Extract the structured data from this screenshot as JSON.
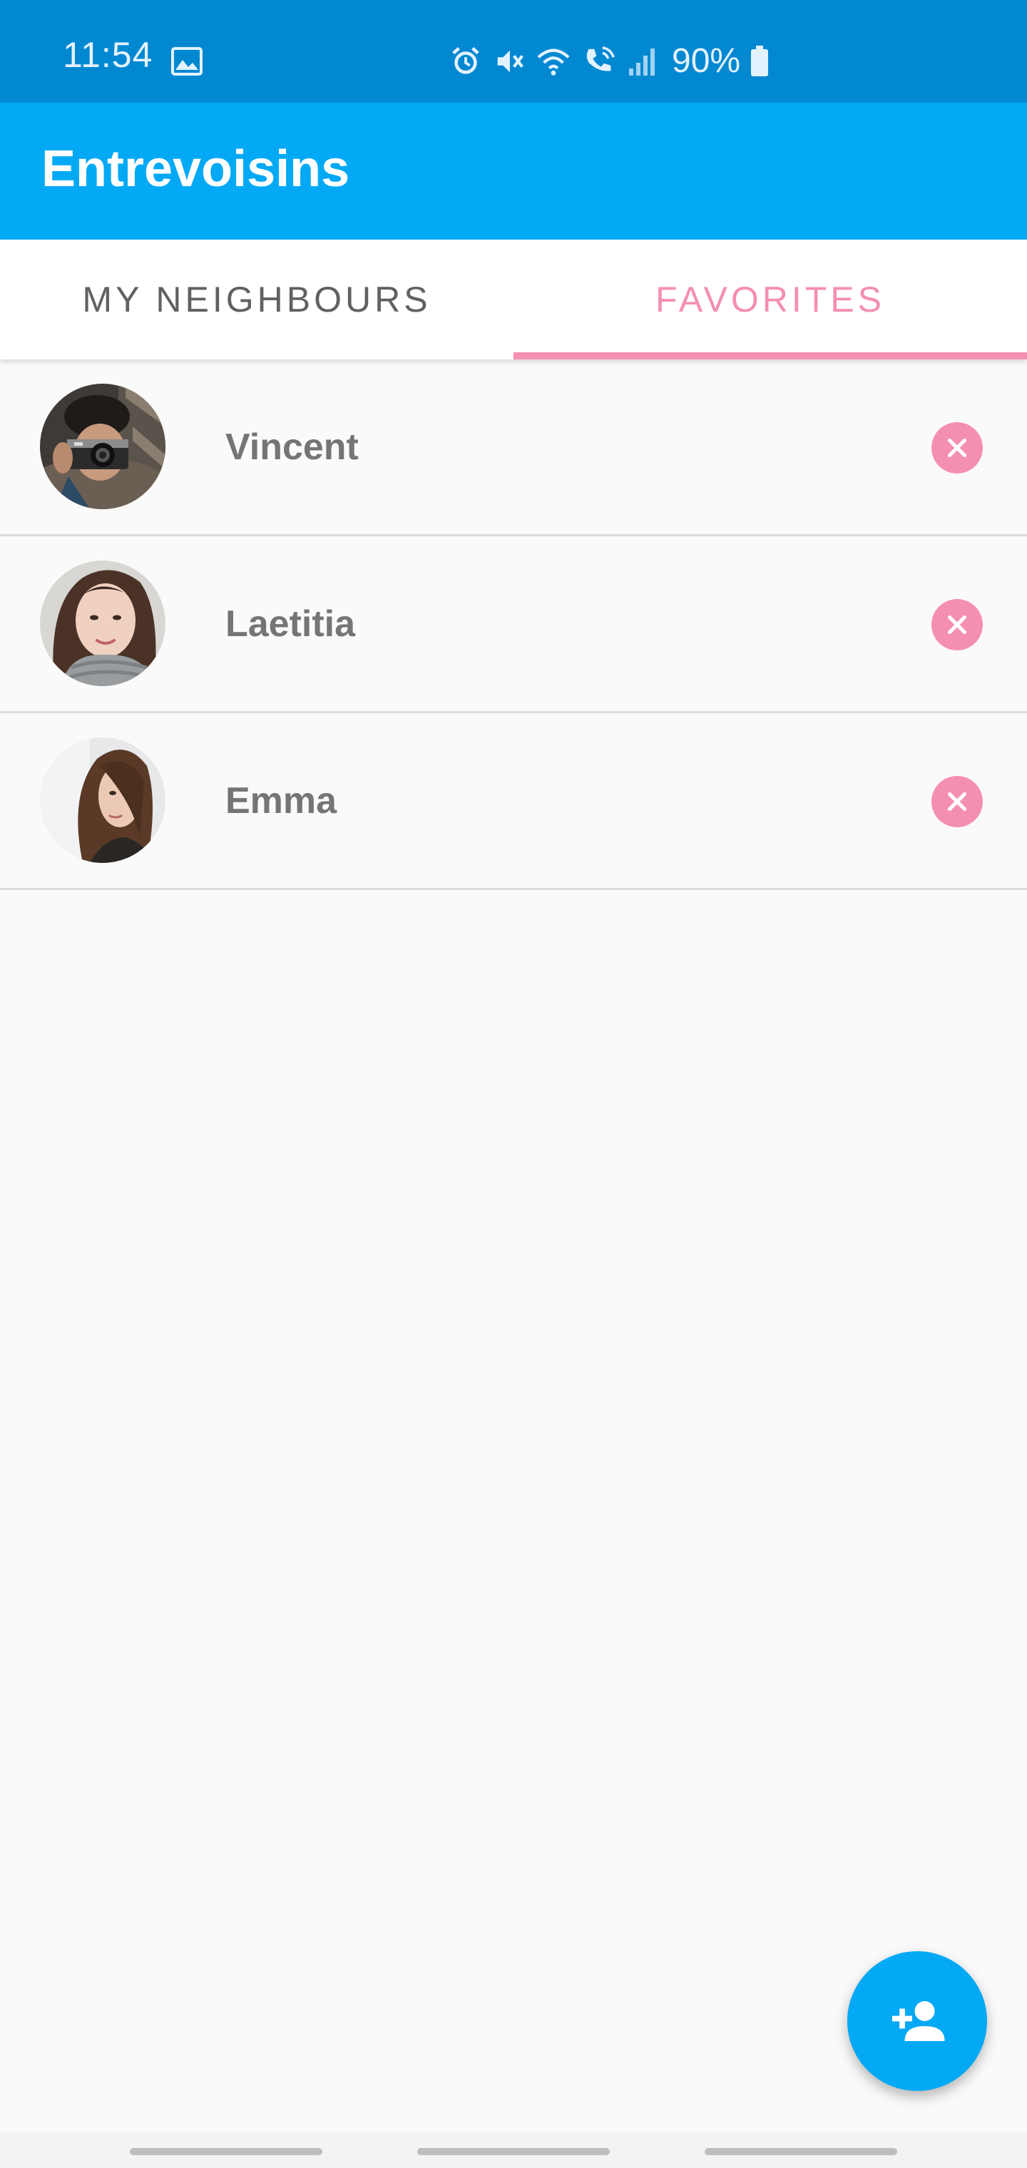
{
  "status_bar": {
    "time": "11:54",
    "battery": "90%",
    "icons": [
      "gallery-icon",
      "alarm-icon",
      "mute-icon",
      "wifi-icon",
      "wifi-call-icon",
      "signal-icon",
      "battery-icon"
    ]
  },
  "app_bar": {
    "title": "Entrevoisins"
  },
  "tabs": [
    {
      "label": "MY NEIGHBOURS",
      "selected": false
    },
    {
      "label": "FAVORITES",
      "selected": true
    }
  ],
  "favorites": [
    {
      "name": "Vincent",
      "avatar": "man-with-camera-photo"
    },
    {
      "name": "Laetitia",
      "avatar": "woman-scarf-photo"
    },
    {
      "name": "Emma",
      "avatar": "woman-profile-photo"
    }
  ],
  "fab": {
    "icon": "add-person-icon"
  },
  "colors": {
    "status_bar": "#0288D1",
    "primary": "#03A9F4",
    "accent": "#F48FB1",
    "tab_inactive": "#616161",
    "name_text": "#757575",
    "background": "#FAFAFA"
  }
}
